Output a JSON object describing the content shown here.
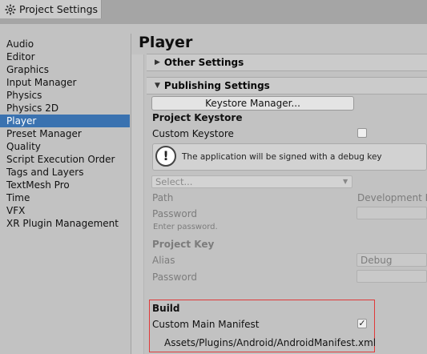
{
  "window": {
    "tab_title": "Project Settings",
    "tab_icon": "gear-icon"
  },
  "sidebar": {
    "items": [
      {
        "label": "Audio"
      },
      {
        "label": "Editor"
      },
      {
        "label": "Graphics"
      },
      {
        "label": "Input Manager"
      },
      {
        "label": "Physics"
      },
      {
        "label": "Physics 2D"
      },
      {
        "label": "Player",
        "active": true
      },
      {
        "label": "Preset Manager"
      },
      {
        "label": "Quality"
      },
      {
        "label": "Script Execution Order"
      },
      {
        "label": "Tags and Layers"
      },
      {
        "label": "TextMesh Pro"
      },
      {
        "label": "Time"
      },
      {
        "label": "VFX"
      },
      {
        "label": "XR Plugin Management"
      }
    ],
    "active_color": "#3a72b0"
  },
  "main": {
    "title": "Player",
    "other_settings": {
      "label": "Other Settings",
      "expanded": false
    },
    "publishing_settings": {
      "label": "Publishing Settings",
      "expanded": true
    },
    "keystore_manager_button": "Keystore Manager...",
    "project_keystore": {
      "heading": "Project Keystore",
      "custom_keystore_label": "Custom Keystore",
      "custom_keystore_checked": false,
      "help_text": "The application will be signed with a debug key",
      "select_placeholder": "Select...",
      "path_label": "Path",
      "path_value": "Development K",
      "password_label": "Password",
      "password_hint": "Enter password."
    },
    "project_key": {
      "heading": "Project Key",
      "alias_label": "Alias",
      "alias_value": "Debug",
      "password_label": "Password"
    },
    "build": {
      "heading": "Build",
      "custom_main_manifest_label": "Custom Main Manifest",
      "custom_main_manifest_checked": true,
      "custom_main_manifest_mark": "✓",
      "manifest_path": "Assets/Plugins/Android/AndroidManifest.xml",
      "highlight_color": "#e03a3a"
    }
  }
}
